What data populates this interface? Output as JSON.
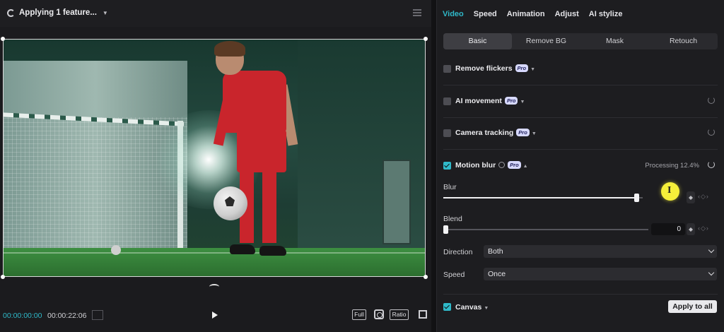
{
  "player": {
    "status_text": "Applying 1 feature...",
    "timecode_current": "00:00:00:00",
    "timecode_total": "00:00:22:06",
    "buttons": {
      "full": "Full",
      "ratio": "Ratio"
    }
  },
  "panel": {
    "tabs": [
      {
        "label": "Video",
        "active": true
      },
      {
        "label": "Speed"
      },
      {
        "label": "Animation"
      },
      {
        "label": "Adjust"
      },
      {
        "label": "AI stylize"
      }
    ],
    "subtabs": [
      {
        "label": "Basic",
        "active": true
      },
      {
        "label": "Remove BG"
      },
      {
        "label": "Mask"
      },
      {
        "label": "Retouch"
      }
    ],
    "pro_badge": "Pro",
    "sections": {
      "remove_flickers": {
        "label": "Remove flickers",
        "checked": false
      },
      "ai_movement": {
        "label": "AI movement",
        "checked": false
      },
      "camera_tracking": {
        "label": "Camera tracking",
        "checked": false
      },
      "motion_blur": {
        "label": "Motion blur",
        "checked": true,
        "processing": "Processing 12.4%"
      },
      "canvas": {
        "label": "Canvas",
        "checked": true
      }
    },
    "blur": {
      "label": "Blur",
      "level": 0.97
    },
    "blend": {
      "label": "Blend",
      "value": "0",
      "level": 0
    },
    "direction": {
      "label": "Direction",
      "value": "Both"
    },
    "speed": {
      "label": "Speed",
      "value": "Once"
    },
    "apply_to_all": "Apply to all",
    "accent_color": "#2fb9c9"
  }
}
